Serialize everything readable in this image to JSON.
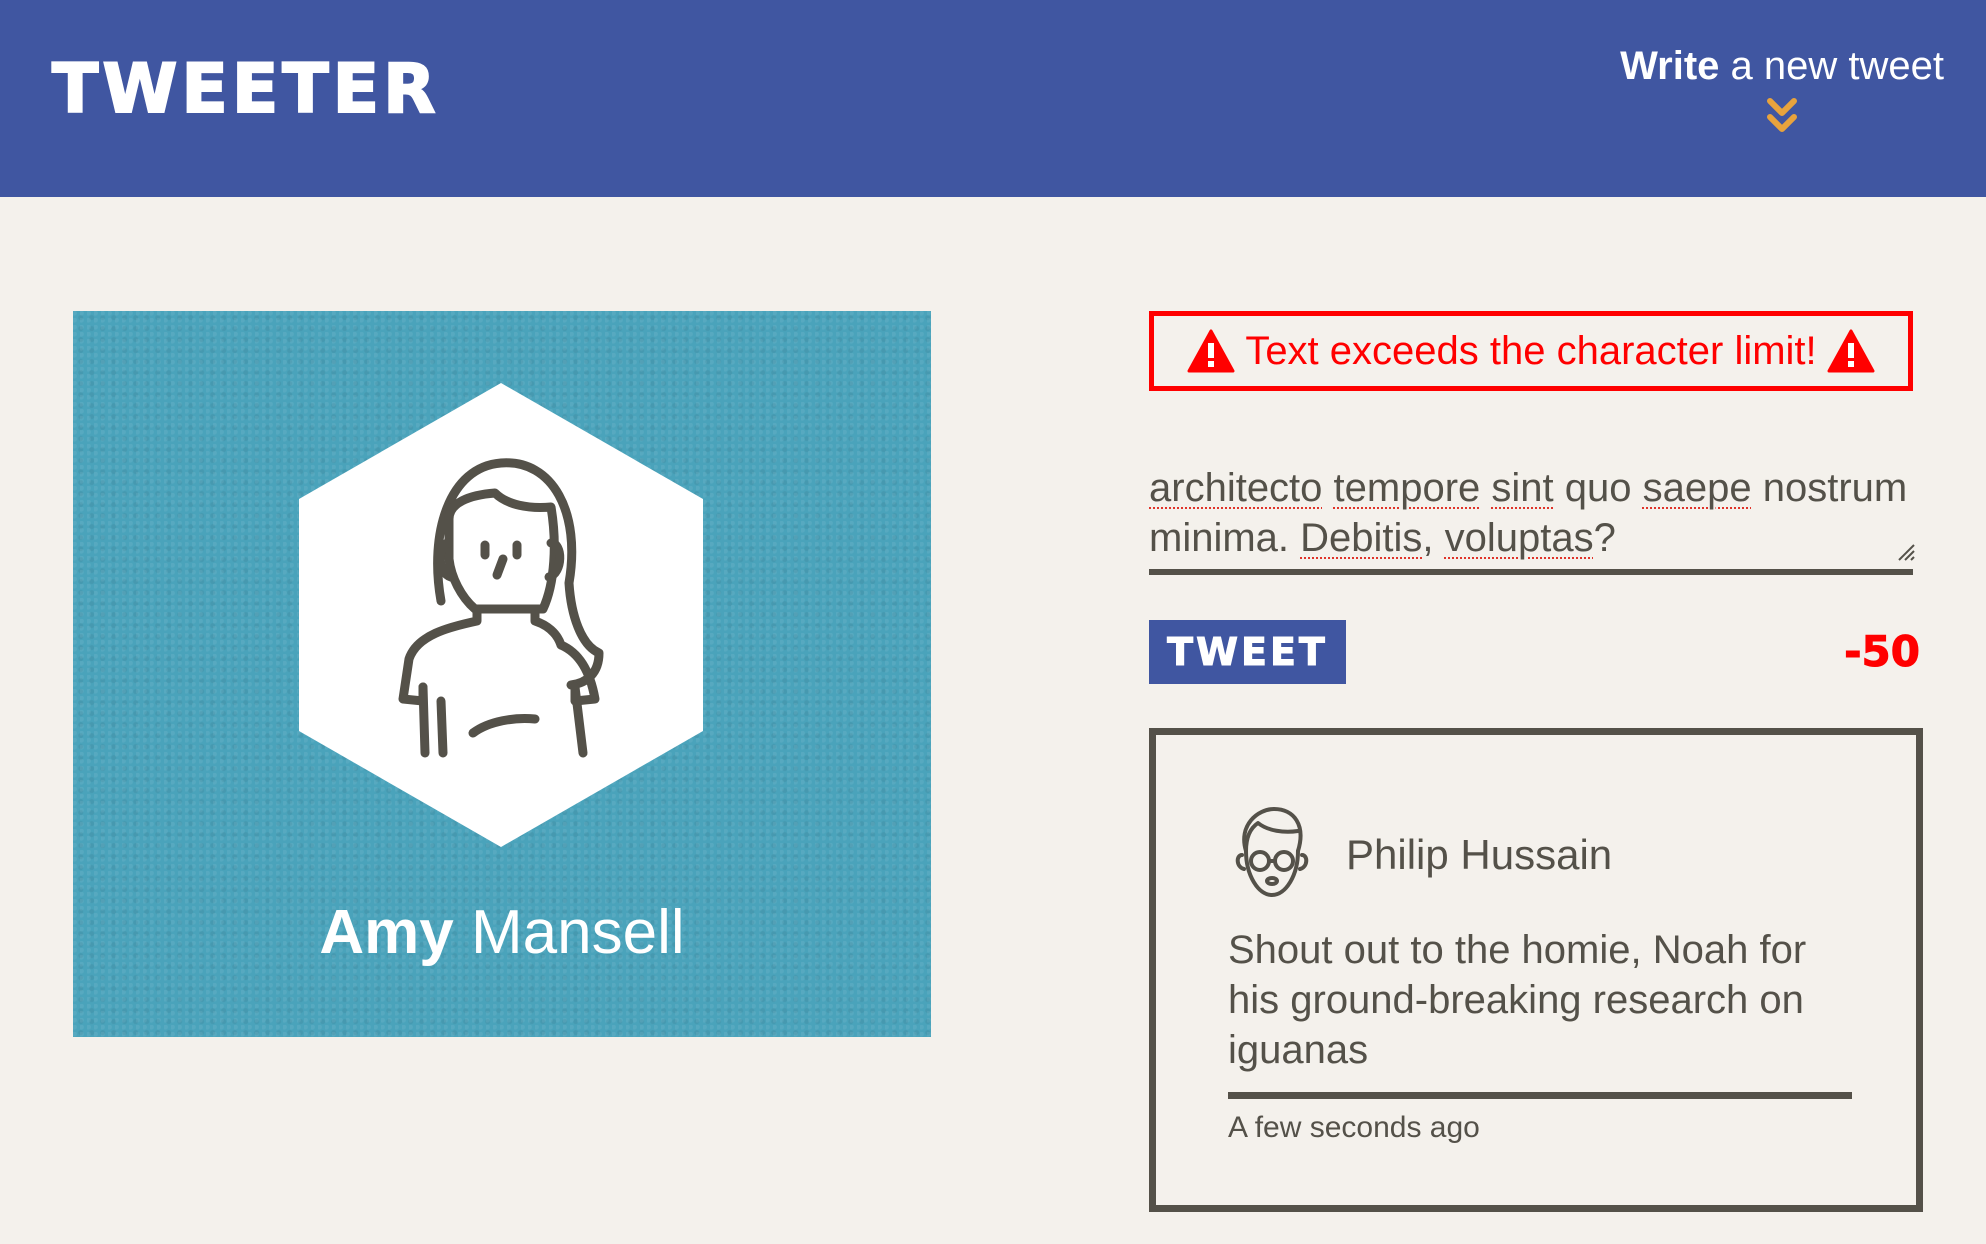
{
  "nav": {
    "brand": "TWEETER",
    "compose_toggle_bold": "Write",
    "compose_toggle_rest": " a new tweet",
    "chevron_icon": "double-chevron-down-icon",
    "colors": {
      "background": "#4056a1",
      "chevron": "#e8a33d"
    }
  },
  "profile": {
    "first_name": "Amy",
    "last_name": " Mansell",
    "avatar_icon": "woman-avatar-icon",
    "background_color": "#4aa3bb"
  },
  "compose": {
    "error_message": "Text exceeds the character limit!",
    "warning_icon": "warning-triangle-icon",
    "error_color": "#ff0000",
    "text_segments": [
      {
        "t": "architecto",
        "spell": true
      },
      {
        "t": " ",
        "spell": false
      },
      {
        "t": "tempore",
        "spell": true
      },
      {
        "t": " ",
        "spell": false
      },
      {
        "t": "sint",
        "spell": true
      },
      {
        "t": " quo ",
        "spell": false
      },
      {
        "t": "saepe",
        "spell": true
      },
      {
        "t": " nostrum minima. ",
        "spell": false
      },
      {
        "t": "Debitis",
        "spell": true
      },
      {
        "t": ", ",
        "spell": false
      },
      {
        "t": "voluptas",
        "spell": true
      },
      {
        "t": "?",
        "spell": false
      }
    ],
    "submit_label": "TWEET",
    "counter": "-50"
  },
  "tweets": [
    {
      "author": "Philip Hussain",
      "avatar_icon": "man-with-glasses-avatar-icon",
      "body": "Shout out to the homie, Noah for his ground-breaking research on iguanas",
      "timestamp": "A few seconds ago"
    }
  ]
}
